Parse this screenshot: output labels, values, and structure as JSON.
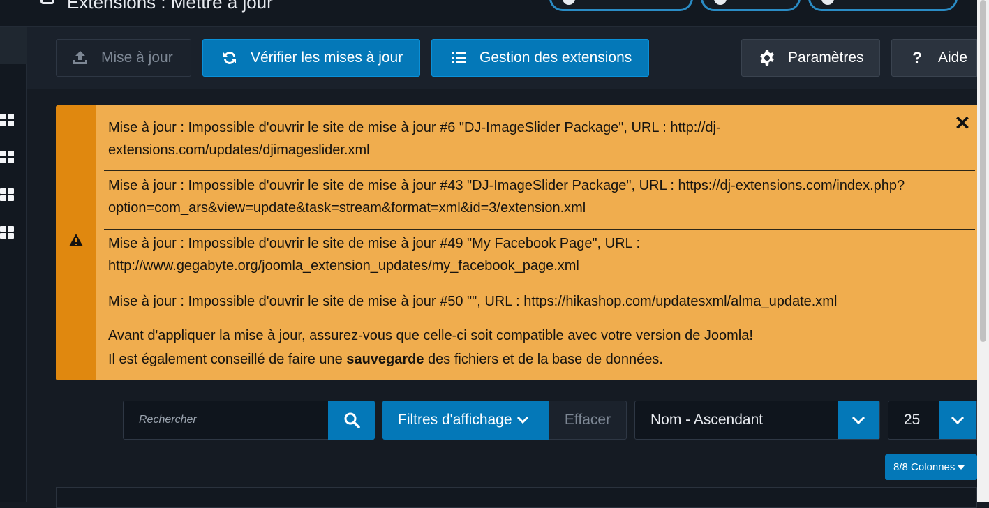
{
  "header": {
    "title": "Extensions : Mettre à jour"
  },
  "toolbar": {
    "update_label": "Mise à jour",
    "check_label": "Vérifier les mises à jour",
    "manage_label": "Gestion des extensions",
    "options_label": "Paramètres",
    "help_label": "Aide"
  },
  "alert": {
    "messages": [
      "Mise à jour : Impossible d'ouvrir le site de mise à jour #6 \"DJ-ImageSlider Package\", URL : http://dj-extensions.com/updates/djimageslider.xml",
      "Mise à jour : Impossible d'ouvrir le site de mise à jour #43 \"DJ-ImageSlider Package\", URL : https://dj-extensions.com/index.php?option=com_ars&view=update&task=stream&format=xml&id=3/extension.xml",
      "Mise à jour : Impossible d'ouvrir le site de mise à jour #49 \"My Facebook Page\", URL : http://www.gegabyte.org/joomla_extension_updates/my_facebook_page.xml",
      "Mise à jour : Impossible d'ouvrir le site de mise à jour #50 \"\", URL : https://hikashop.com/updatesxml/alma_update.xml"
    ],
    "notice_line1": "Avant d'appliquer la mise à jour, assurez-vous que celle-ci soit compatible avec votre version de Joomla!",
    "notice_line2_pre": "Il est également conseillé de faire une ",
    "notice_line2_bold": "sauvegarde",
    "notice_line2_post": " des fichiers et de la base de données."
  },
  "filters": {
    "search_placeholder": "Rechercher",
    "filter_options_label": "Filtres d'affichage",
    "clear_label": "Effacer",
    "sort_value": "Nom - Ascendant",
    "limit_value": "25",
    "columns_label": "8/8 Colonnes"
  },
  "colors": {
    "accent": "#0478b8",
    "warning_bg": "#f0ad4e",
    "warning_side": "#e0880f",
    "background": "#151b23"
  }
}
